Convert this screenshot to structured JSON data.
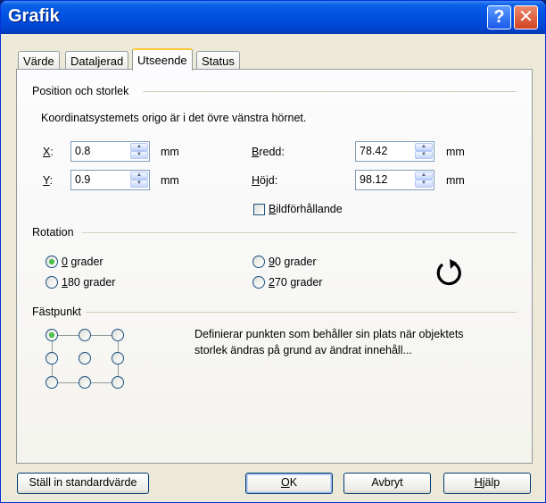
{
  "window": {
    "title": "Grafik",
    "help_glyph": "?",
    "close_glyph": "✕"
  },
  "tabs": [
    {
      "label": "Värde"
    },
    {
      "label": "Dataljerad"
    },
    {
      "label": "Utseende"
    },
    {
      "label": "Status"
    }
  ],
  "position": {
    "section_label": "Position och storlek",
    "note": "Koordinatsystemets origo är i det övre vänstra hörnet.",
    "x_label_key": "X",
    "x_label_rest": ":",
    "x_value": "0.8",
    "y_label_key": "Y",
    "y_label_rest": ":",
    "y_value": "0.9",
    "unit": "mm",
    "width_label_key": "B",
    "width_label_rest": "redd:",
    "width_value": "78.42",
    "height_label_key": "H",
    "height_label_rest": "öjd:",
    "height_value": "98.12",
    "aspect_key": "B",
    "aspect_rest": "ildförhållande",
    "aspect_checked": false
  },
  "rotation": {
    "section_label": "Rotation",
    "options": [
      {
        "key": "0",
        "rest": " grader",
        "selected": true
      },
      {
        "key": "1",
        "rest": "80 grader",
        "selected": false
      },
      {
        "key": "9",
        "rest": "0 grader",
        "selected": false
      },
      {
        "key": "2",
        "rest": "70 grader",
        "selected": false
      }
    ],
    "rotate_glyph": "↻"
  },
  "anchor": {
    "section_label": "Fästpunkt",
    "description_line1": "Definierar punkten som behåller sin plats när objektets",
    "description_line2": "storlek ändras på grund av ändrat innehåll...",
    "selected_index": 0
  },
  "buttons": {
    "defaults": "Ställ in standardvärde",
    "ok_key": "O",
    "ok_rest": "K",
    "cancel": "Avbryt",
    "help_key": "H",
    "help_rest": "jälp"
  }
}
